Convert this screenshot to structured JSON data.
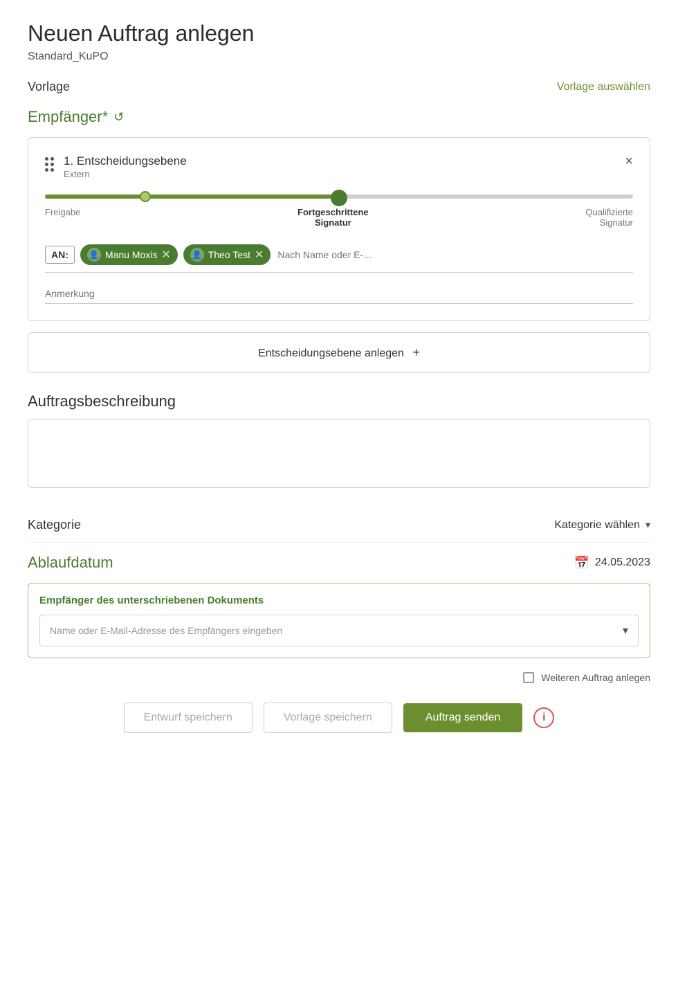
{
  "page": {
    "title": "Neuen Auftrag anlegen",
    "subtitle": "Standard_KuPO"
  },
  "vorlage": {
    "label": "Vorlage",
    "action": "Vorlage auswählen"
  },
  "empfaenger": {
    "title": "Empfänger*"
  },
  "card": {
    "level": "1. Entscheidungsebene",
    "extern": "Extern",
    "close": "×",
    "slider": {
      "labels": [
        "Freigabe",
        "Fortgeschrittene\nSignatur",
        "Qualifizierte\nSignatur"
      ],
      "active_index": 1
    },
    "an_label": "AN:",
    "recipients": [
      {
        "name": "Manu Moxis"
      },
      {
        "name": "Theo Test"
      }
    ],
    "search_placeholder": "Nach Name oder E-...",
    "anmerkung_placeholder": "Anmerkung"
  },
  "add_level": {
    "label": "Entscheidungsebene anlegen",
    "plus": "+"
  },
  "auftragsbeschreibung": {
    "label": "Auftragsbeschreibung",
    "placeholder": ""
  },
  "kategorie": {
    "label": "Kategorie",
    "select_label": "Kategorie wählen"
  },
  "ablaufdatum": {
    "label": "Ablaufdatum",
    "date": "24.05.2023"
  },
  "signed_doc": {
    "title": "Empfänger des unterschriebenen Dokuments",
    "placeholder": "Name oder E-Mail-Adresse des Empfängers eingeben"
  },
  "weiteren": {
    "label": "Weiteren Auftrag anlegen"
  },
  "buttons": {
    "entwurf": "Entwurf speichern",
    "vorlage": "Vorlage speichern",
    "senden": "Auftrag senden",
    "info": "i"
  }
}
